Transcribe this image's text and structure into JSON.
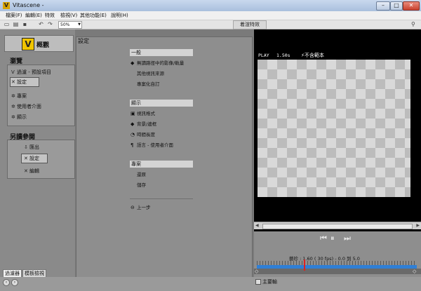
{
  "window": {
    "title": "Vitascene -",
    "app_icon": "V",
    "buttons": {
      "minimize": "–",
      "maximize": "□",
      "close": "✕"
    }
  },
  "menu": [
    "檔案(F)",
    "編輯(E)",
    "特效",
    "檢視(V)",
    "其他功能(E)",
    "說明(H)"
  ],
  "toolbar": {
    "icons": [
      "new-file-icon",
      "open-folder-icon",
      "save-icon",
      "undo-icon",
      "redo-icon"
    ],
    "zoom_value": "50%",
    "fx_button": "着渲特效"
  },
  "left_panel": {
    "logo_mark": "V",
    "logo_text": "概觀",
    "browse_title": "瀏覽",
    "browse_items": [
      {
        "icon": "V",
        "label": "過濾 - 預設項目"
      },
      {
        "icon": "✕",
        "label": "設定"
      },
      {
        "icon": "✲",
        "label": "專案"
      },
      {
        "icon": "✲",
        "label": "使用者介面"
      },
      {
        "icon": "✲",
        "label": "顯示"
      }
    ],
    "saveas_title": "另讀參閱",
    "saveas_items": [
      {
        "icon": "⇩",
        "label": "匯出"
      },
      {
        "icon": "✕",
        "label": "設定"
      },
      {
        "icon": "✕",
        "label": "編輯"
      }
    ]
  },
  "bottom_tabs": [
    "過濾器",
    "模板檢視"
  ],
  "settings": {
    "title": "設定",
    "sections": [
      {
        "header": "一般",
        "items": [
          {
            "icon": "◆",
            "label": "無讀路徑中的影像/軌量"
          },
          {
            "icon": "",
            "label": "其他視訊來源"
          },
          {
            "icon": "",
            "label": "專案化自訂"
          }
        ]
      },
      {
        "header": "顯示",
        "items": [
          {
            "icon": "▣",
            "label": "視訊格式"
          },
          {
            "icon": "◆",
            "label": "背景/邊框"
          },
          {
            "icon": "◔",
            "label": "時間長度"
          },
          {
            "icon": "¶",
            "label": "語言 - 使用者介面"
          }
        ]
      },
      {
        "header": "專案",
        "items": [
          {
            "icon": "",
            "label": "還原"
          },
          {
            "icon": "",
            "label": "儲存"
          }
        ]
      }
    ],
    "back_label": "上一步"
  },
  "preview": {
    "play_label": "PLAY",
    "play_time": "1.50s",
    "no_sample": "不含範本"
  },
  "player": {
    "prev": "⏮",
    "pause": "⏸",
    "next": "⏭",
    "time_info": "藝珍 : 1.60 ( 30   fps) - 0.0 到  5.0",
    "main_sequence": "主要輸"
  }
}
